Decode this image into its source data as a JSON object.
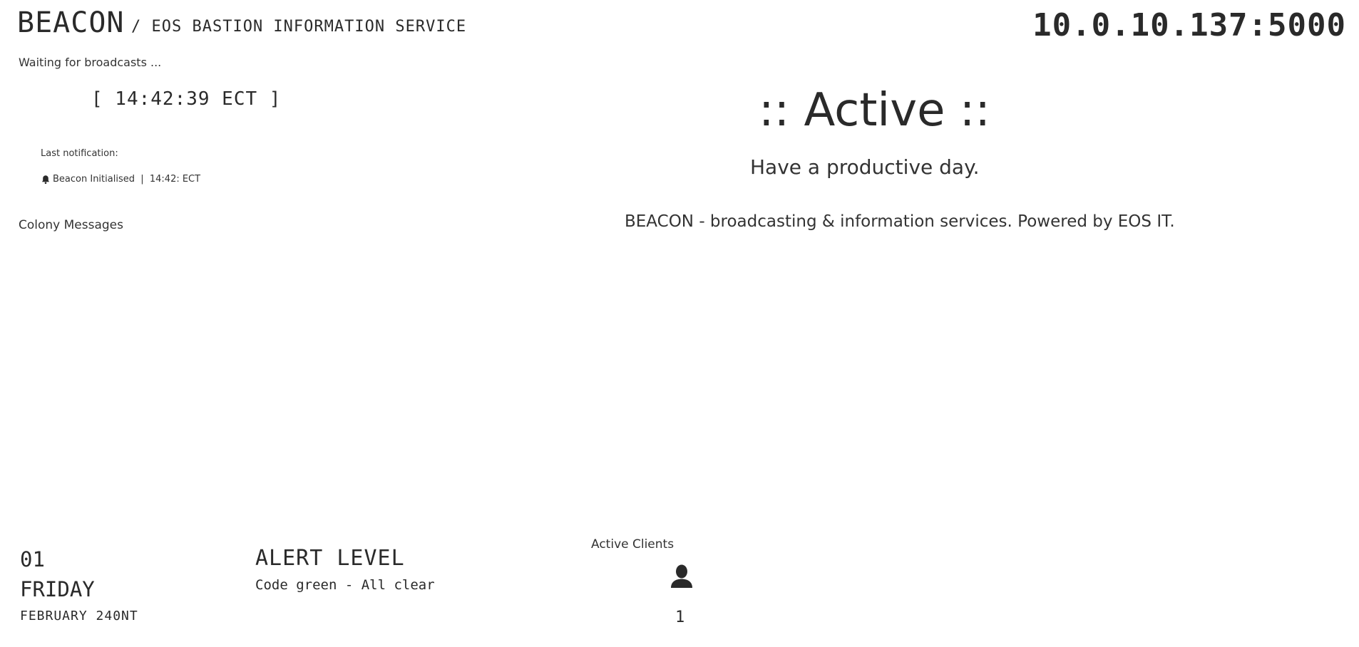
{
  "header": {
    "brand": "BEACON",
    "subtitle": "/ EOS BASTION INFORMATION SERVICE",
    "address": "10.0.10.137:5000"
  },
  "left": {
    "waiting": "Waiting for broadcasts ...",
    "clock": "[ 14:42:39 ECT ]",
    "last_notification_label": "Last notification:",
    "last_notification": {
      "icon": "bell-icon",
      "text": "Beacon Initialised  |  14:42: ECT"
    },
    "colony_messages_label": "Colony Messages"
  },
  "center": {
    "status": ":: Active ::",
    "greeting": "Have a productive day.",
    "footer": "BEACON - broadcasting & information services. Powered by EOS IT."
  },
  "bottom": {
    "date": {
      "day": "01",
      "weekday": "FRIDAY",
      "month_year": "FEBRUARY 240NT"
    },
    "alert": {
      "title": "ALERT LEVEL",
      "text": "Code green - All clear"
    },
    "clients": {
      "label": "Active Clients",
      "icon": "user-icon",
      "count": "1"
    }
  },
  "colors": {
    "text": "#2a2a2a",
    "background": "#ffffff"
  }
}
